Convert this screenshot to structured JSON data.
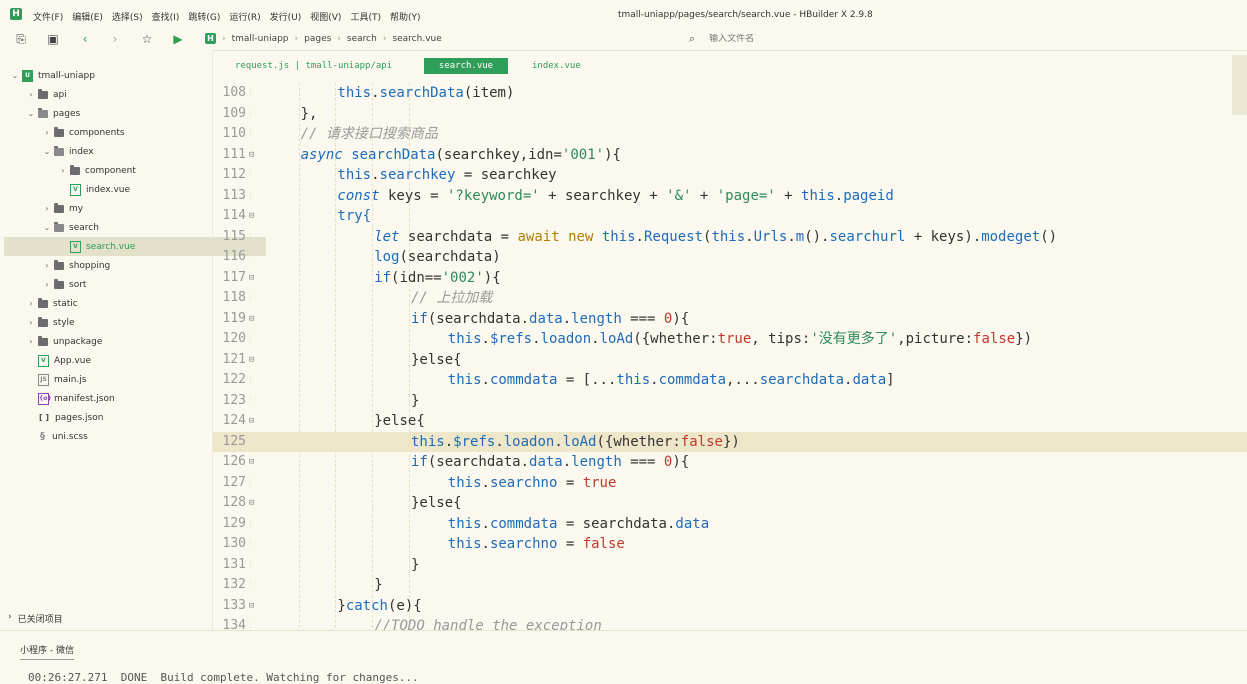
{
  "app": {
    "logo": "H",
    "title": "tmall-uniapp/pages/search/search.vue - HBuilder X 2.9.8",
    "menu": [
      "文件(F)",
      "编辑(E)",
      "选择(S)",
      "查找(I)",
      "跳转(G)",
      "运行(R)",
      "发行(U)",
      "视图(V)",
      "工具(T)",
      "帮助(Y)"
    ]
  },
  "toolbar": {
    "breadcrumb": [
      "tmall-uniapp",
      "pages",
      "search",
      "search.vue"
    ],
    "file_search_placeholder": "输入文件名"
  },
  "sidebar": {
    "items": [
      {
        "label": "tmall-uniapp",
        "type": "project",
        "expanded": true,
        "depth": 0
      },
      {
        "label": "api",
        "type": "folder",
        "expanded": false,
        "depth": 1
      },
      {
        "label": "pages",
        "type": "folder",
        "expanded": true,
        "depth": 1
      },
      {
        "label": "components",
        "type": "folder",
        "expanded": false,
        "depth": 2
      },
      {
        "label": "index",
        "type": "folder",
        "expanded": true,
        "depth": 2
      },
      {
        "label": "component",
        "type": "folder",
        "expanded": false,
        "depth": 3
      },
      {
        "label": "index.vue",
        "type": "vue",
        "depth": 3
      },
      {
        "label": "my",
        "type": "folder",
        "expanded": false,
        "depth": 2
      },
      {
        "label": "search",
        "type": "folder",
        "expanded": true,
        "depth": 2
      },
      {
        "label": "search.vue",
        "type": "vue",
        "depth": 3,
        "active": true
      },
      {
        "label": "shopping",
        "type": "folder",
        "expanded": false,
        "depth": 2
      },
      {
        "label": "sort",
        "type": "folder",
        "expanded": false,
        "depth": 2
      },
      {
        "label": "static",
        "type": "folder",
        "expanded": false,
        "depth": 1
      },
      {
        "label": "style",
        "type": "folder",
        "expanded": false,
        "depth": 1
      },
      {
        "label": "unpackage",
        "type": "folder",
        "expanded": false,
        "depth": 1
      },
      {
        "label": "App.vue",
        "type": "vue",
        "depth": 1
      },
      {
        "label": "main.js",
        "type": "js",
        "depth": 1
      },
      {
        "label": "manifest.json",
        "type": "manifest",
        "depth": 1
      },
      {
        "label": "pages.json",
        "type": "json",
        "depth": 1
      },
      {
        "label": "uni.scss",
        "type": "scss",
        "depth": 1
      }
    ],
    "closed_projects": "已关闭项目"
  },
  "tabs": [
    {
      "label": "request.js | tmall-uniapp/api",
      "active": false
    },
    {
      "label": "search.vue",
      "active": true
    },
    {
      "label": "index.vue",
      "active": false
    }
  ],
  "editor": {
    "current_line": 125,
    "lines": [
      {
        "n": "108",
        "fold": false,
        "indent": 3,
        "code": "this.searchData(item)"
      },
      {
        "n": "109",
        "fold": false,
        "indent": 2,
        "code": "},"
      },
      {
        "n": "110",
        "fold": false,
        "indent": 2,
        "code": "// 请求接口搜索商品"
      },
      {
        "n": "111",
        "fold": true,
        "indent": 2,
        "code": "async searchData(searchkey,idn='001'){"
      },
      {
        "n": "112",
        "fold": false,
        "indent": 3,
        "code": "this.searchkey = searchkey"
      },
      {
        "n": "113",
        "fold": false,
        "indent": 3,
        "code": "const keys = '?keyword=' + searchkey + '&' + 'page=' + this.pageid"
      },
      {
        "n": "114",
        "fold": true,
        "indent": 3,
        "code": "try{"
      },
      {
        "n": "115",
        "fold": false,
        "indent": 4,
        "code": "let searchdata = await new this.Request(this.Urls.m().searchurl + keys).modeget()"
      },
      {
        "n": "116",
        "fold": false,
        "indent": 4,
        "code": "log(searchdata)"
      },
      {
        "n": "117",
        "fold": true,
        "indent": 4,
        "code": "if(idn=='002'){"
      },
      {
        "n": "118",
        "fold": false,
        "indent": 5,
        "code": "// 上拉加载"
      },
      {
        "n": "119",
        "fold": true,
        "indent": 5,
        "code": "if(searchdata.data.length === 0){"
      },
      {
        "n": "120",
        "fold": false,
        "indent": 6,
        "code": "this.$refs.loadon.loAd({whether:true, tips:'没有更多了',picture:false})"
      },
      {
        "n": "121",
        "fold": true,
        "indent": 5,
        "code": "}else{"
      },
      {
        "n": "122",
        "fold": false,
        "indent": 6,
        "code": "this.commdata = [...this.commdata,...searchdata.data]"
      },
      {
        "n": "123",
        "fold": false,
        "indent": 5,
        "code": "}"
      },
      {
        "n": "124",
        "fold": true,
        "indent": 4,
        "code": "}else{"
      },
      {
        "n": "125",
        "fold": false,
        "indent": 5,
        "code": "this.$refs.loadon.loAd({whether:false})"
      },
      {
        "n": "126",
        "fold": true,
        "indent": 5,
        "code": "if(searchdata.data.length === 0){"
      },
      {
        "n": "127",
        "fold": false,
        "indent": 6,
        "code": "this.searchno = true"
      },
      {
        "n": "128",
        "fold": true,
        "indent": 5,
        "code": "}else{"
      },
      {
        "n": "129",
        "fold": false,
        "indent": 6,
        "code": "this.commdata = searchdata.data"
      },
      {
        "n": "130",
        "fold": false,
        "indent": 6,
        "code": "this.searchno = false"
      },
      {
        "n": "131",
        "fold": false,
        "indent": 5,
        "code": "}"
      },
      {
        "n": "132",
        "fold": false,
        "indent": 4,
        "code": "}"
      },
      {
        "n": "133",
        "fold": true,
        "indent": 3,
        "code": "}catch(e){"
      },
      {
        "n": "134",
        "fold": false,
        "indent": 4,
        "code": "//TODO handle the exception"
      }
    ]
  },
  "console": {
    "tab": "小程序 - 微信",
    "line": "00:26:27.271  DONE  Build complete. Watching for changes..."
  }
}
